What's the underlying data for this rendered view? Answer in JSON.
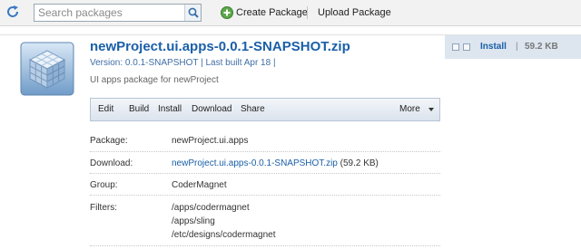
{
  "toolbar": {
    "search_placeholder": "Search packages",
    "create_label": "Create Package",
    "upload_label": "Upload Package"
  },
  "package": {
    "title": "newProject.ui.apps-0.0.1-SNAPSHOT.zip",
    "meta": "Version: 0.0.1-SNAPSHOT | Last built Apr 18 |",
    "description": "UI apps package for newProject",
    "install_label": "Install",
    "separator": "|",
    "size": "59.2 KB"
  },
  "actions": {
    "items": [
      "Edit",
      "Build",
      "Install",
      "Download",
      "Share"
    ],
    "more_label": "More"
  },
  "details": {
    "package_label": "Package:",
    "package_value": "newProject.ui.apps",
    "download_label": "Download:",
    "download_link": "newProject.ui.apps-0.0.1-SNAPSHOT.zip",
    "download_size": "(59.2 KB)",
    "group_label": "Group:",
    "group_value": "CoderMagnet",
    "filters_label": "Filters:",
    "filters": [
      "/apps/codermagnet",
      "/apps/sling",
      "/etc/designs/codermagnet"
    ]
  }
}
